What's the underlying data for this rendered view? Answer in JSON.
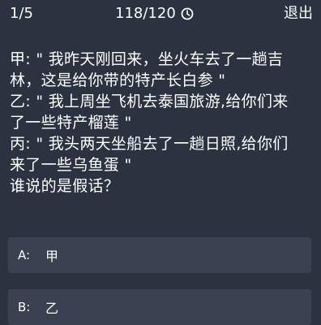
{
  "header": {
    "progress": "1/5",
    "timer": "118/120",
    "timer_icon": "clock-icon",
    "exit_label": "退出"
  },
  "question": {
    "lines": [
      "甲: \" 我昨天刚回来，坐火车去了一趟吉",
      "林，这是给你带的特产长白参 \"",
      "乙: \" 我上周坐飞机去泰国旅游,给你们来",
      "了一些特产榴莲 \"",
      "丙: \" 我头两天坐船去了一趟日照,给你们",
      "来了一些乌鱼蛋 \"",
      "谁说的是假话？"
    ]
  },
  "options": [
    {
      "letter": "A:",
      "text": "甲"
    },
    {
      "letter": "B:",
      "text": "乙"
    }
  ]
}
